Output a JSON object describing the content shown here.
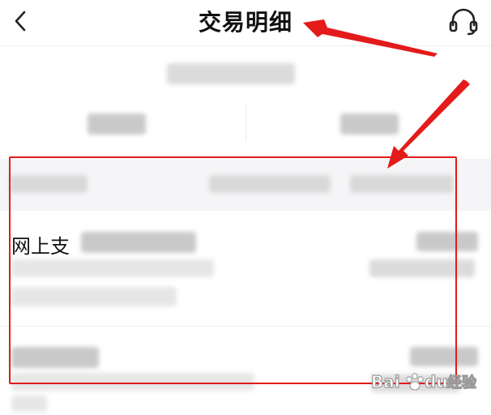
{
  "header": {
    "back_icon": "chevron-left-icon",
    "title": "交易明细",
    "service_icon": "headset-icon"
  },
  "list": {
    "first_item_prefix": "网上支"
  },
  "annotations": {
    "arrow_color": "#e31b1b",
    "highlight_color": "#e31b1b"
  },
  "watermark": {
    "brand": "Bai",
    "brand2": "du",
    "suffix": "经验"
  }
}
